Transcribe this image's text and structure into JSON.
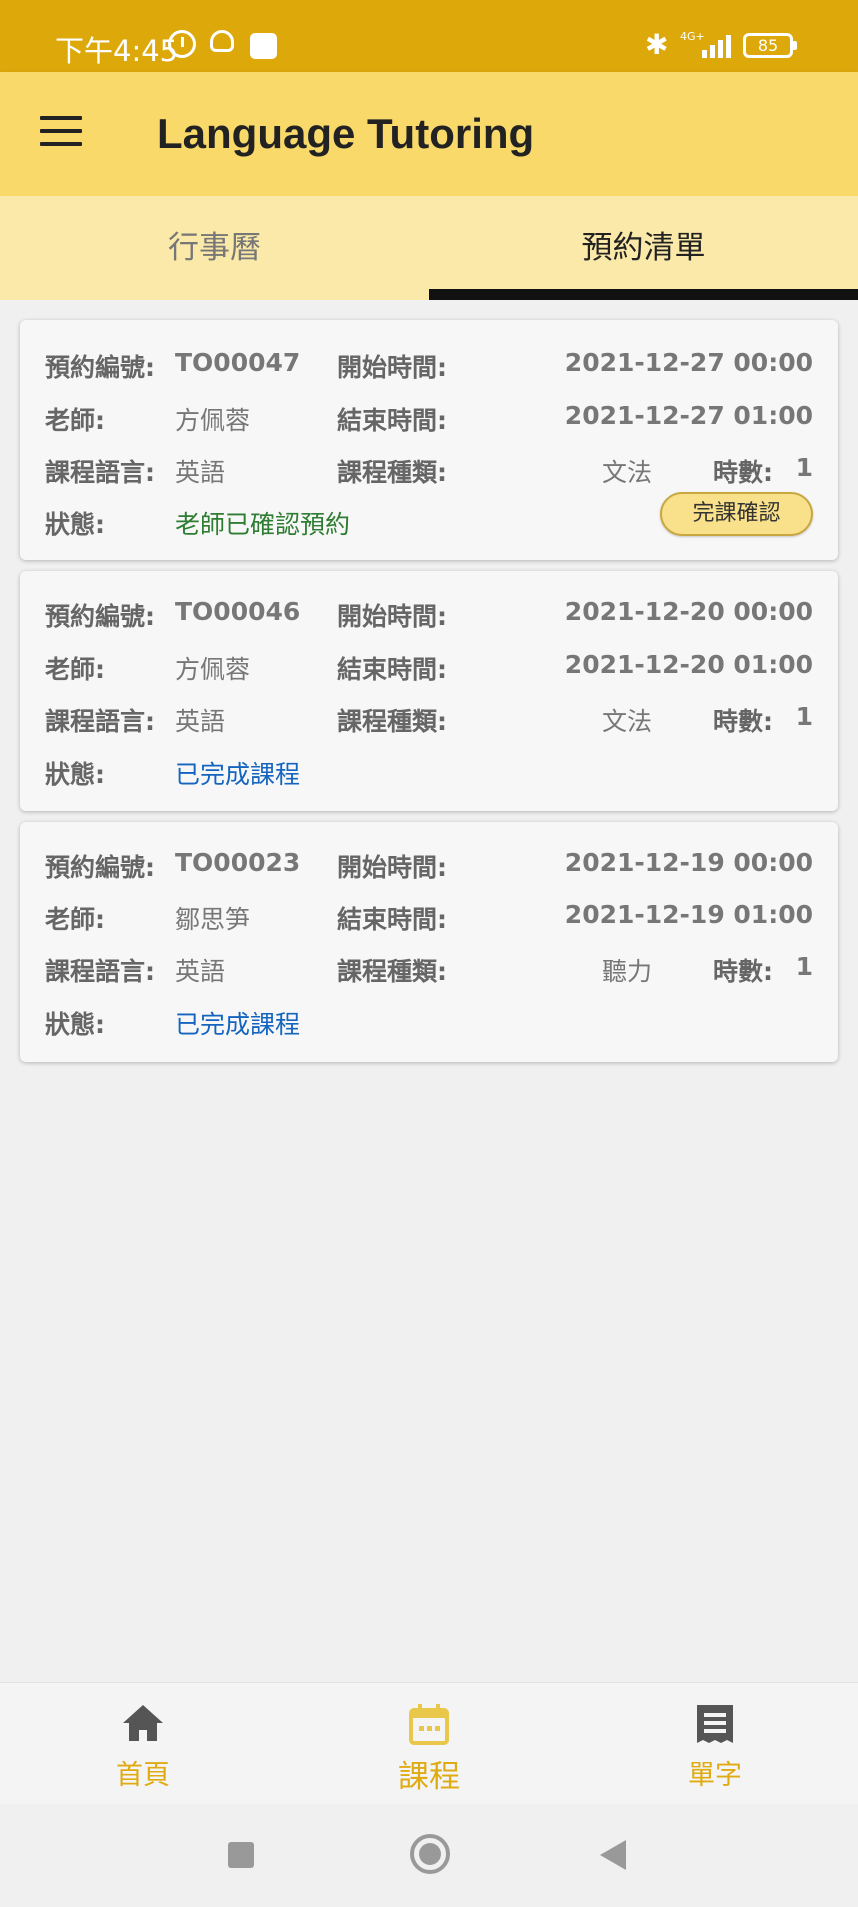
{
  "status_bar": {
    "time": "下午4:45",
    "network": "4G+",
    "battery": "85"
  },
  "app": {
    "title": "Language Tutoring"
  },
  "tabs": [
    {
      "label": "行事曆"
    },
    {
      "label": "預約清單"
    }
  ],
  "labels": {
    "booking_no": "預約編號:",
    "teacher": "老師:",
    "language": "課程語言:",
    "status": "狀態:",
    "start_time": "開始時間:",
    "end_time": "結束時間:",
    "course_type": "課程種類:",
    "hours": "時數:"
  },
  "bookings": [
    {
      "booking_no": "TO00047",
      "teacher": "方佩蓉",
      "language": "英語",
      "status": "老師已確認預約",
      "start_time": "2021-12-27 00:00",
      "end_time": "2021-12-27 01:00",
      "course_type": "文法",
      "hours": "1",
      "action_label": "完課確認"
    },
    {
      "booking_no": "TO00046",
      "teacher": "方佩蓉",
      "language": "英語",
      "status": "已完成課程",
      "start_time": "2021-12-20 00:00",
      "end_time": "2021-12-20 01:00",
      "course_type": "文法",
      "hours": "1"
    },
    {
      "booking_no": "TO00023",
      "teacher": "鄒思笋",
      "language": "英語",
      "status": "已完成課程",
      "start_time": "2021-12-19 00:00",
      "end_time": "2021-12-19 01:00",
      "course_type": "聽力",
      "hours": "1"
    }
  ],
  "bottom_nav": [
    {
      "label": "首頁",
      "icon": "home-icon"
    },
    {
      "label": "課程",
      "icon": "calendar-icon"
    },
    {
      "label": "單字",
      "icon": "list-icon"
    }
  ],
  "colors": {
    "status_bar": "#dca80a",
    "app_bar": "#f8d96a",
    "tabs": "#fae9a8",
    "accent": "#e0ab12",
    "status_confirmed": "#2e7d32",
    "status_done": "#1565c0"
  }
}
